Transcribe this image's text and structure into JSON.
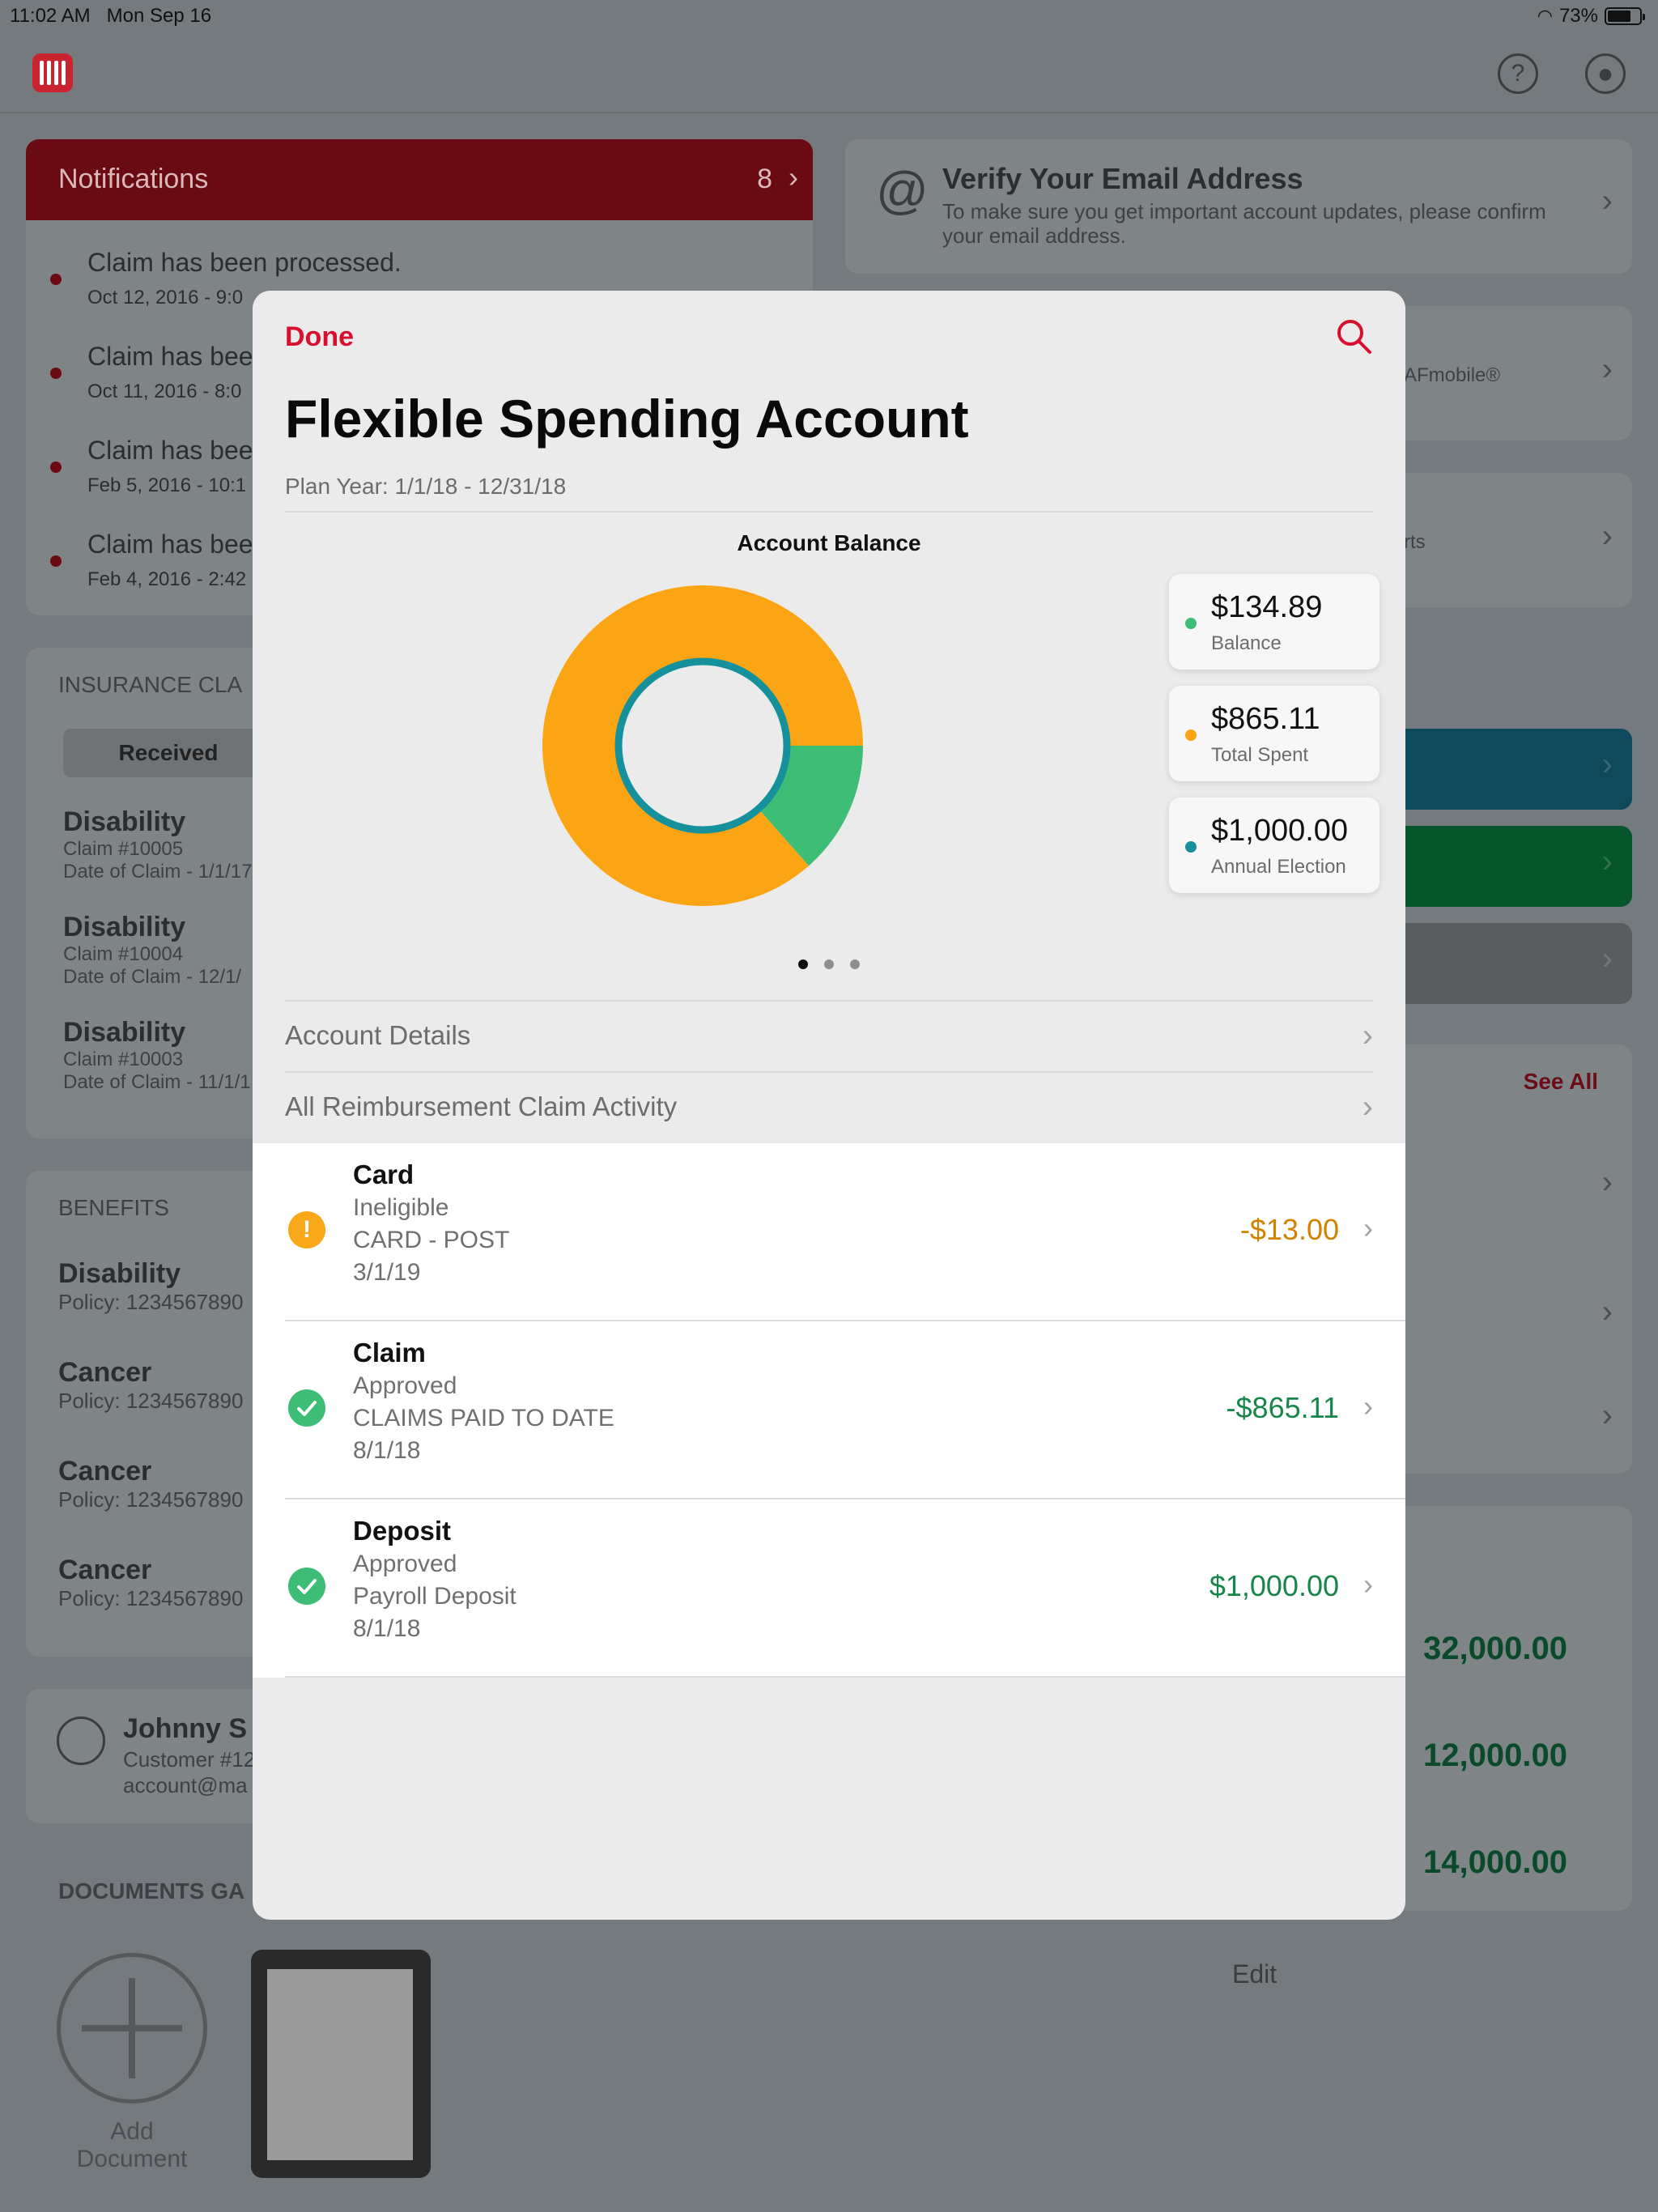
{
  "status_bar": {
    "time": "11:02 AM",
    "date": "Mon Sep 16",
    "battery": "73%",
    "battery_level": 0.73
  },
  "background": {
    "notifications": {
      "title": "Notifications",
      "count": "8",
      "items": [
        {
          "text": "Claim has been processed.",
          "date": "Oct 12, 2016 - 9:0"
        },
        {
          "text": "Claim has bee",
          "date": "Oct 11, 2016 - 8:0"
        },
        {
          "text": "Claim has bee",
          "date": "Feb 5, 2016 - 10:1"
        },
        {
          "text": "Claim has bee",
          "date": "Feb 4, 2016 - 2:42"
        }
      ]
    },
    "insurance_claims": {
      "title": "INSURANCE CLA",
      "tab": "Received",
      "claims": [
        {
          "type": "Disability",
          "number": "Claim #10005",
          "date": "Date of Claim - 1/1/17"
        },
        {
          "type": "Disability",
          "number": "Claim #10004",
          "date": "Date of Claim - 12/1/"
        },
        {
          "type": "Disability",
          "number": "Claim #10003",
          "date": "Date of Claim - 11/1/1"
        }
      ]
    },
    "benefits": {
      "title": "BENEFITS",
      "items": [
        {
          "type": "Disability",
          "policy": "Policy: 1234567890"
        },
        {
          "type": "Cancer",
          "policy": "Policy: 1234567890"
        },
        {
          "type": "Cancer",
          "policy": "Policy: 1234567890"
        },
        {
          "type": "Cancer",
          "policy": "Policy: 1234567890"
        }
      ]
    },
    "profile": {
      "name": "Johnny S",
      "customer": "Customer #12",
      "email": "account@ma"
    },
    "documents": {
      "title": "DOCUMENTS GA",
      "add_label": "Add\nDocument"
    },
    "verify_email": {
      "title": "Verify Your Email Address",
      "body": "To make sure you get important account updates, please confirm your email address."
    },
    "afmobile_text": "AFmobile®",
    "rts_text": "rts",
    "see_all": "See All",
    "amounts": [
      "32,000.00",
      "12,000.00",
      "14,000.00"
    ],
    "edit": "Edit"
  },
  "modal": {
    "done": "Done",
    "title": "Flexible Spending Account",
    "plan_year": "Plan Year:  1/1/18 - 12/31/18",
    "chart_title": "Account Balance",
    "legend": [
      {
        "amount": "$134.89",
        "label": "Balance",
        "color": "#3dbd76"
      },
      {
        "amount": "$865.11",
        "label": "Total Spent",
        "color": "#fca514"
      },
      {
        "amount": "$1,000.00",
        "label": "Annual Election",
        "color": "#16919c"
      }
    ],
    "nav": [
      {
        "label": "Account Details"
      },
      {
        "label": "All Reimbursement Claim Activity"
      }
    ],
    "transactions": [
      {
        "title": "Card",
        "status": "Ineligible",
        "desc": "CARD - POST",
        "date": "3/1/19",
        "amount": "-$13.00",
        "amount_color": "#d18300",
        "icon": "warning-icon",
        "icon_color": "#f9a81a"
      },
      {
        "title": "Claim",
        "status": "Approved",
        "desc": "CLAIMS PAID TO DATE",
        "date": "8/1/18",
        "amount": "-$865.11",
        "amount_color": "#18864a",
        "icon": "check-icon",
        "icon_color": "#3dbd76"
      },
      {
        "title": "Deposit",
        "status": "Approved",
        "desc": "Payroll Deposit",
        "date": "8/1/18",
        "amount": "$1,000.00",
        "amount_color": "#18864a",
        "icon": "check-icon",
        "icon_color": "#3dbd76"
      }
    ]
  },
  "chart_data": {
    "type": "pie",
    "title": "Account Balance",
    "categories": [
      "Balance",
      "Total Spent"
    ],
    "values": [
      134.89,
      865.11
    ],
    "total": 1000.0,
    "colors": [
      "#3dbd76",
      "#fca514"
    ],
    "inner_ring_color": "#16919c"
  }
}
